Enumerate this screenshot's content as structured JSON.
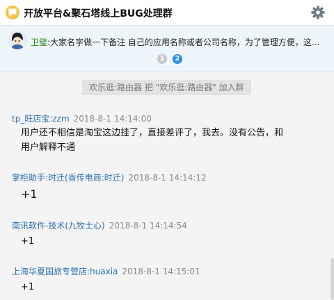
{
  "header": {
    "group_name": "开放平台&聚石塔线上BUG处理群",
    "icons": {
      "group": "chat-group-icon",
      "settings": "gear-icon"
    }
  },
  "announcement": {
    "author": "卫璧",
    "separator": ":",
    "text": "大家名字做一下备注 自己的应用名称或者公司名称，为了管理方便，这...",
    "pages": [
      "1",
      "2"
    ],
    "active_page": "2"
  },
  "chat": {
    "system_message": "欢乐逛:路由器 把 \"欢乐逛:路由器\" 加入群",
    "messages": [
      {
        "sender": "tp_旺店宝:zzm",
        "time": "2018-8-1 14:14:00",
        "lines": [
          "用户还不相信是淘宝这边挂了，直接差评了，我去。没有公告，和",
          "用户解释不通"
        ]
      },
      {
        "sender": "掌柜助手:时迁(香传电商:时迁)",
        "time": "2018-8-1 14:14:12",
        "lines": [
          "+1"
        ]
      },
      {
        "sender": "南讯软件-技术(九牧士心)",
        "time": "2018-8-1 14:14:54",
        "lines": [
          "+1"
        ]
      },
      {
        "sender": "上海华夏国旅专营店:huaxia",
        "time": "2018-8-1 14:15:01",
        "lines": [
          "+1"
        ]
      }
    ]
  },
  "colors": {
    "sender": "#2a6fb4",
    "announcement_author": "#2f8b1a",
    "pager_active": "#2e8ee0",
    "announcement_bg": "#eef5fb"
  }
}
